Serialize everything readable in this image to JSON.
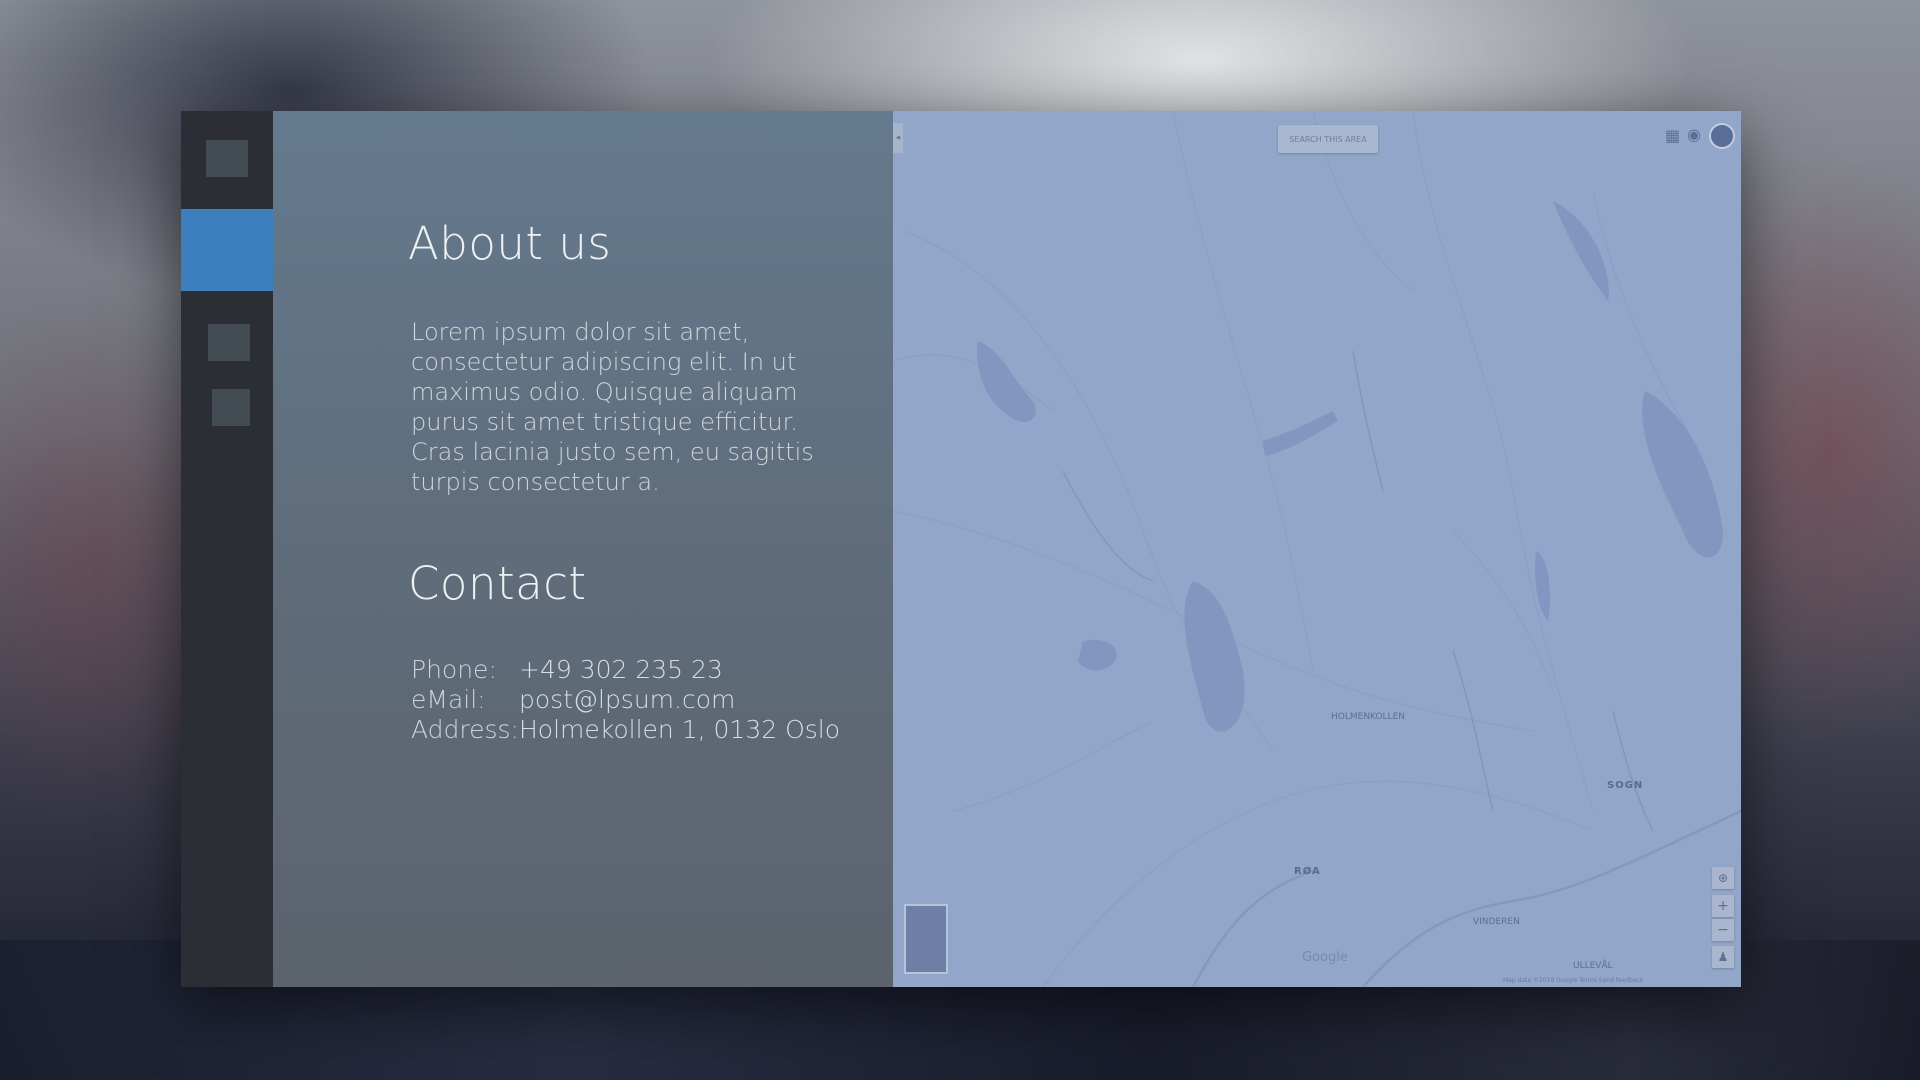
{
  "sidebar": {
    "items": [
      {
        "name": "nav-item-1",
        "active": false
      },
      {
        "name": "nav-item-2",
        "active": true
      },
      {
        "name": "nav-item-3",
        "active": false
      },
      {
        "name": "nav-item-4",
        "active": false
      }
    ],
    "active_color": "#3b7fbe"
  },
  "about": {
    "title": "About us",
    "text": "Lorem ipsum dolor sit amet, consectetur adipiscing elit. In ut maximus odio. Quisque aliquam purus sit amet tristique efficitur. Cras lacinia justo sem, eu sagittis turpis consectetur a."
  },
  "contact": {
    "title": "Contact",
    "phone_label": "Phone:",
    "phone_value": "+49 302 235 23",
    "email_label": "eMail:",
    "email_value": "post@lpsum.com",
    "address_label": "Address:",
    "address_value": "Holmekollen 1, 0132 Oslo"
  },
  "map": {
    "search_button": "SEARCH THIS AREA",
    "labels": {
      "holmenkollen": "HOLMENKOLLEN",
      "sogn": "SOGN",
      "roa": "RØA",
      "ullevaal": "ULLEVÅL",
      "vinderen": "VINDEREN"
    },
    "google": "Google",
    "attribution": "Map data ©2018 Google   Terms   Send feedback",
    "icons": [
      "apps-icon",
      "location-icon",
      "account-avatar",
      "compass-icon",
      "zoom-in-icon",
      "zoom-out-icon",
      "pegman-icon"
    ],
    "zoom_in": "+",
    "zoom_out": "−",
    "collapse": "◂"
  }
}
